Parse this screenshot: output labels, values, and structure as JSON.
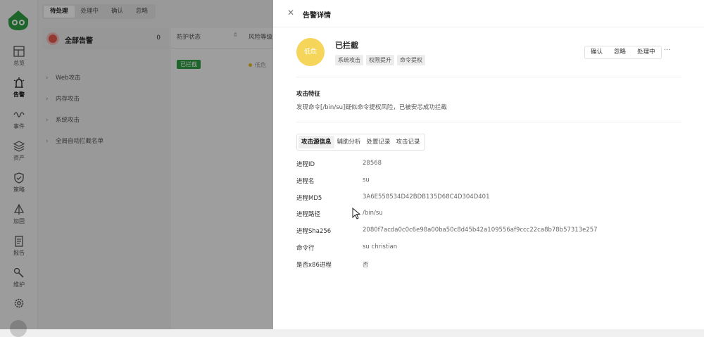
{
  "nav": {
    "items": [
      {
        "label": "总览",
        "icon": "overview-icon"
      },
      {
        "label": "告警",
        "icon": "alert-icon"
      },
      {
        "label": "事件",
        "icon": "event-icon"
      },
      {
        "label": "资产",
        "icon": "asset-icon"
      },
      {
        "label": "策略",
        "icon": "policy-icon"
      },
      {
        "label": "加固",
        "icon": "harden-icon"
      },
      {
        "label": "报告",
        "icon": "report-icon"
      },
      {
        "label": "维护",
        "icon": "maintenance-icon"
      }
    ]
  },
  "list": {
    "tabs": [
      "待处理",
      "处理中",
      "确认",
      "忽略"
    ],
    "all_alerts": {
      "label": "全部告警",
      "count": "0"
    },
    "tree": [
      "Web攻击",
      "内存攻击",
      "系统攻击",
      "全局自动拦截名单"
    ],
    "columns": [
      "防护状态",
      "风险等级"
    ],
    "row": {
      "status": "已拦截",
      "risk": "低危"
    }
  },
  "drawer": {
    "title": "告警详情",
    "level": "低危",
    "status": "已拦截",
    "tags": [
      "系统攻击",
      "权限提升",
      "命令提权"
    ],
    "actions": [
      "确认",
      "忽略",
      "处理中"
    ],
    "more": "···",
    "feature_title": "攻击特征",
    "feature_desc": "发现命令[/bin/su]疑似命令提权风险，已被安芯成功拦截",
    "subtabs": [
      "攻击源信息",
      "辅助分析",
      "处置记录",
      "攻击记录"
    ],
    "details": [
      {
        "label": "进程ID",
        "value": "28568"
      },
      {
        "label": "进程名",
        "value": "su"
      },
      {
        "label": "进程MD5",
        "value": "3A6E558534D42BDB135D68C4D304D401"
      },
      {
        "label": "进程路径",
        "value": "/bin/su"
      },
      {
        "label": "进程Sha256",
        "value": "2080f7acda0c0c6e98a00ba50c8d45b42a109556af9ccc22ca8b78b57313e257"
      },
      {
        "label": "命令行",
        "value": "su christian"
      },
      {
        "label": "是否x86进程",
        "value": "否"
      }
    ]
  },
  "colors": {
    "accent_green": "#2f9e44",
    "level_yellow": "#f5d55a",
    "alert_red": "#e85a4f"
  }
}
